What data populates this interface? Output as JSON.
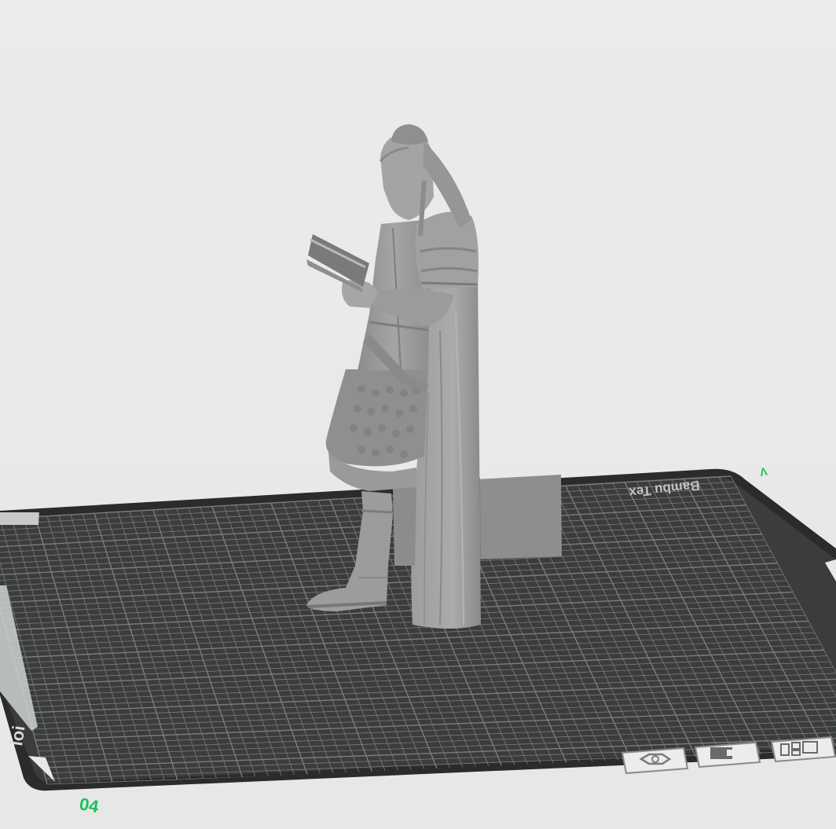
{
  "viewport": {
    "name": "3D build plate preview",
    "background_color": "#ebebeb",
    "plate_color": "#3b3c3d",
    "grid_color": "#7a7c7e",
    "model_color": "#9a9a9a"
  },
  "plate": {
    "brand_text": "Bambu Tex",
    "corner_marker": "ioi"
  },
  "axes": {
    "x_label": "04",
    "y_label": "Λ",
    "color": "#19c25a"
  },
  "toolbar": {
    "icons": [
      {
        "name": "nut-icon",
        "label": "plate-settings"
      },
      {
        "name": "lock-icon",
        "label": "lock-plate"
      },
      {
        "name": "arrange-icon",
        "label": "arrange"
      }
    ]
  },
  "objects": [
    {
      "name": "figure-model",
      "description": "standing figure reading a book"
    },
    {
      "name": "wipe-tower",
      "description": "prime tower block"
    }
  ]
}
